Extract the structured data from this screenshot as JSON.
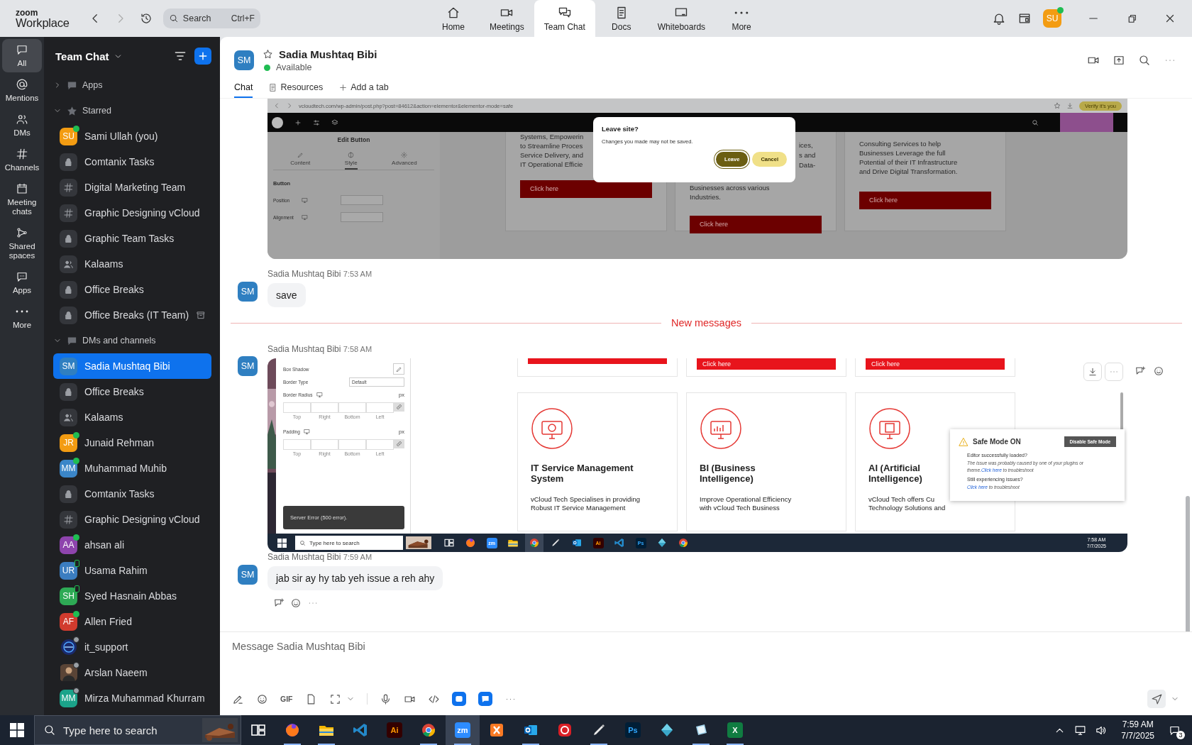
{
  "top_bar": {
    "logo": {
      "line1": "zoom",
      "line2": "Workplace"
    },
    "search": {
      "placeholder": "Search",
      "shortcut": "Ctrl+F"
    },
    "tabs": [
      {
        "label": "Home",
        "selected": false
      },
      {
        "label": "Meetings",
        "selected": false
      },
      {
        "label": "Team Chat",
        "selected": true
      },
      {
        "label": "Docs",
        "selected": false
      },
      {
        "label": "Whiteboards",
        "selected": false
      },
      {
        "label": "More",
        "selected": false
      }
    ],
    "profile": {
      "initials": "SU",
      "color": "#f39c12",
      "presence": {
        "kind": "online"
      }
    }
  },
  "rail": [
    {
      "label": "All",
      "selected": true
    },
    {
      "label": "Mentions",
      "selected": false
    },
    {
      "label": "DMs",
      "selected": false
    },
    {
      "label": "Channels",
      "selected": false
    },
    {
      "label": "Meeting chats",
      "selected": false
    },
    {
      "label": "Shared spaces",
      "selected": false
    },
    {
      "label": "Apps",
      "selected": false
    },
    {
      "label": "More",
      "selected": false
    }
  ],
  "sidebar": {
    "title": "Team Chat",
    "sections": [
      {
        "label": "Apps",
        "kind": "apps",
        "expanded": false
      },
      {
        "label": "Starred",
        "kind": "starred",
        "expanded": true,
        "items": [
          {
            "name": "Sami Ullah (you)",
            "kind": "avatar",
            "initials": "SU",
            "color": "#f39c12",
            "presence": {
              "kind": "online"
            },
            "selected": false,
            "archived": false
          },
          {
            "name": "Comtanix Tasks",
            "kind": "private",
            "selected": false,
            "archived": false
          },
          {
            "name": "Digital Marketing Team",
            "kind": "channel",
            "selected": false,
            "archived": false
          },
          {
            "name": "Graphic Designing vCloud",
            "kind": "channel",
            "selected": false,
            "archived": false
          },
          {
            "name": "Graphic Team Tasks",
            "kind": "private",
            "selected": false,
            "archived": false
          },
          {
            "name": "Kalaams",
            "kind": "group",
            "selected": false,
            "archived": false
          },
          {
            "name": "Office Breaks",
            "kind": "private",
            "selected": false,
            "archived": false
          },
          {
            "name": "Office Breaks (IT Team)",
            "kind": "private",
            "selected": false,
            "archived": true
          }
        ]
      },
      {
        "label": "DMs and channels",
        "kind": "dms",
        "expanded": true,
        "items": [
          {
            "name": "Sadia Mushtaq Bibi",
            "kind": "avatar",
            "initials": "SM",
            "color": "#2f7fc1",
            "selected": true,
            "archived": false
          },
          {
            "name": "Office Breaks",
            "kind": "private",
            "selected": false,
            "archived": false
          },
          {
            "name": "Kalaams",
            "kind": "group",
            "selected": false,
            "archived": false
          },
          {
            "name": "Junaid Rehman",
            "kind": "avatar",
            "initials": "JR",
            "color": "#f39c12",
            "presence": {
              "kind": "online"
            },
            "selected": false,
            "archived": false
          },
          {
            "name": "Muhammad Muhib",
            "kind": "avatar",
            "initials": "MM",
            "color": "#3b86c8",
            "presence": {
              "kind": "online"
            },
            "selected": false,
            "archived": false
          },
          {
            "name": "Comtanix Tasks",
            "kind": "private",
            "selected": false,
            "archived": false
          },
          {
            "name": "Graphic Designing vCloud",
            "kind": "channel",
            "selected": false,
            "archived": false
          },
          {
            "name": "ahsan ali",
            "kind": "avatar",
            "initials": "AA",
            "color": "#8e44ad",
            "presence": {
              "kind": "online"
            },
            "selected": false,
            "archived": false
          },
          {
            "name": "Usama Rahim",
            "kind": "avatar",
            "initials": "UR",
            "color": "#3b7dc0",
            "presence": {
              "kind": "mobile"
            },
            "selected": false,
            "archived": false
          },
          {
            "name": "Syed Hasnain Abbas",
            "kind": "avatar",
            "initials": "SH",
            "color": "#2eaa55",
            "presence": {
              "kind": "mobile"
            },
            "selected": false,
            "archived": false
          },
          {
            "name": "Allen Fried",
            "kind": "avatar",
            "initials": "AF",
            "color": "#d13b2e",
            "presence": {
              "kind": "online"
            },
            "selected": false,
            "archived": false
          },
          {
            "name": "it_support",
            "kind": "logo",
            "presence": {
              "kind": "away"
            },
            "selected": false,
            "archived": false
          },
          {
            "name": "Arslan Naeem",
            "presence": {
              "kind": "away"
            },
            "selected": false,
            "archived": false
          },
          {
            "name": "Mirza Muhammad Khurram",
            "kind": "avatar",
            "initials": "MM",
            "color": "#1ba38a",
            "presence": {
              "kind": "away"
            },
            "selected": false,
            "archived": false
          }
        ]
      }
    ]
  },
  "chat": {
    "contact": {
      "initials": "SM",
      "color": "#2f7fc1",
      "name": "Sadia Mushtaq Bibi",
      "status": "Available",
      "starred": false
    },
    "tabs": [
      {
        "label": "Chat",
        "selected": true
      },
      {
        "label": "Resources",
        "selected": false
      },
      {
        "label": "Add a tab",
        "selected": false
      }
    ],
    "messages": [
      {
        "kind": "browser_image",
        "url": "vcloudtech.com/wp-admin/post.php?post=84612&action=elementor&elementor-mode=safe",
        "verify": "Verify it's you",
        "panel": {
          "title": "Edit Button",
          "tabs": [
            {
              "label": "Content",
              "selected": false
            },
            {
              "label": "Style",
              "selected": true
            },
            {
              "label": "Advanced",
              "selected": false
            }
          ],
          "section": "Button",
          "rows": [
            "Position",
            "Alignment"
          ]
        },
        "cards": [
          {
            "lines": [
              "Systems, Empowerin",
              "to Streamline Proces",
              "Service Delivery, and",
              "IT Operational Efficie"
            ],
            "button": "Click here"
          },
          {
            "tail_lines": [
              "ices,",
              "s and",
              "Data-"
            ],
            "lines": [
              "Businesses across various",
              "Industries."
            ],
            "button": "Click here"
          },
          {
            "lines": [
              "Consulting Services to help",
              "Businesses Leverage the full",
              "Potential of their IT Infrastructure",
              "and Drive Digital Transformation."
            ],
            "button": "Click here"
          }
        ],
        "dialog": {
          "title": "Leave site?",
          "text": "Changes you made may not be saved.",
          "buttons": [
            "Leave",
            "Cancel"
          ]
        }
      },
      {
        "kind": "text",
        "initials": "SM",
        "color": "#2f7fc1",
        "sender": "Sadia Mushtaq Bibi",
        "time": "7:53 AM",
        "text": "save"
      },
      {
        "kind": "divider",
        "text": "New messages"
      },
      {
        "kind": "desktop_image",
        "initials": "SM",
        "color": "#2f7fc1",
        "sender": "Sadia Mushtaq Bibi",
        "time": "7:58 AM",
        "panel": {
          "rows": [
            {
              "kind": "pencil",
              "label": "Box Shadow"
            },
            {
              "kind": "select",
              "label": "Border Type",
              "value": "Default"
            },
            {
              "kind": "dims",
              "label": "Border Radius",
              "unit": "px",
              "sides": [
                "Top",
                "Right",
                "Bottom",
                "Left"
              ]
            },
            {
              "kind": "dims",
              "label": "Padding",
              "unit": "px",
              "sides": [
                "Top",
                "Right",
                "Bottom",
                "Left"
              ]
            }
          ],
          "toast": "Server Error (500 error)."
        },
        "top_cards": [
          {
            "kind": "cut"
          },
          {
            "kind": "labelled",
            "button": "Click here"
          },
          {
            "kind": "labelled",
            "button": "Click here"
          }
        ],
        "cards": [
          {
            "title": "IT Service Management System",
            "lines": [
              "vCloud Tech Specialises in providing",
              "Robust IT Service Management"
            ]
          },
          {
            "title": "BI (Business Intelligence)",
            "lines": [
              "Improve Operational Efficiency",
              "with vCloud Tech Business"
            ]
          },
          {
            "title": "AI (Artificial Intelligence)",
            "lines": [
              "vCloud Tech offers Cu",
              "Technology Solutions and"
            ]
          }
        ],
        "safe_mode": {
          "title": "Safe Mode ON",
          "button": "Disable Safe Mode",
          "items": [
            {
              "heading": "Editor successfully loaded?",
              "text": "The issue was probably caused by one of your plugins or theme.",
              "link": "Click here",
              "after": "to troubleshoot"
            },
            {
              "heading": "Still experiencing issues?",
              "link": "Click here",
              "after": "to troubleshoot"
            }
          ]
        },
        "taskbar": {
          "search_placeholder": "Type here to search",
          "time": "7:58 AM",
          "date": "7/7/2025",
          "apps": [
            {
              "selected": false
            },
            {
              "selected": false
            },
            {
              "label": "zm",
              "selected": false
            },
            {
              "selected": false
            },
            {
              "selected": true
            },
            {
              "selected": false
            },
            {
              "selected": false
            },
            {
              "label": "Ai",
              "selected": false
            },
            {
              "selected": false
            },
            {
              "label": "Ps",
              "selected": false
            },
            {
              "selected": false
            },
            {
              "selected": false
            }
          ]
        }
      },
      {
        "kind": "text",
        "initials": "SM",
        "color": "#2f7fc1",
        "sender": "Sadia Mushtaq Bibi",
        "time": "7:59 AM",
        "text": "jab sir ay hy tab yeh issue a reh ahy"
      }
    ]
  },
  "composer": {
    "placeholder": "Message Sadia Mushtaq Bibi",
    "gif": "GIF"
  },
  "taskbar": {
    "search_placeholder": "Type here to search",
    "time": "7:59 AM",
    "date": "7/7/2025",
    "notifications": "3",
    "apps": [
      {
        "selected": false,
        "running": false
      },
      {
        "selected": false,
        "running": true
      },
      {
        "selected": false,
        "running": true
      },
      {
        "selected": false,
        "running": false
      },
      {
        "label": "Ai",
        "selected": false,
        "running": false
      },
      {
        "selected": false,
        "running": true
      },
      {
        "label": "zm",
        "selected": true,
        "running": true
      },
      {
        "selected": false,
        "running": false
      },
      {
        "selected": false,
        "running": true
      },
      {
        "selected": false,
        "running": false
      },
      {
        "selected": false,
        "running": true
      },
      {
        "label": "Ps",
        "selected": false,
        "running": false
      },
      {
        "selected": false,
        "running": false
      },
      {
        "selected": false,
        "running": true
      },
      {
        "label": "X",
        "selected": false,
        "running": true
      }
    ]
  }
}
